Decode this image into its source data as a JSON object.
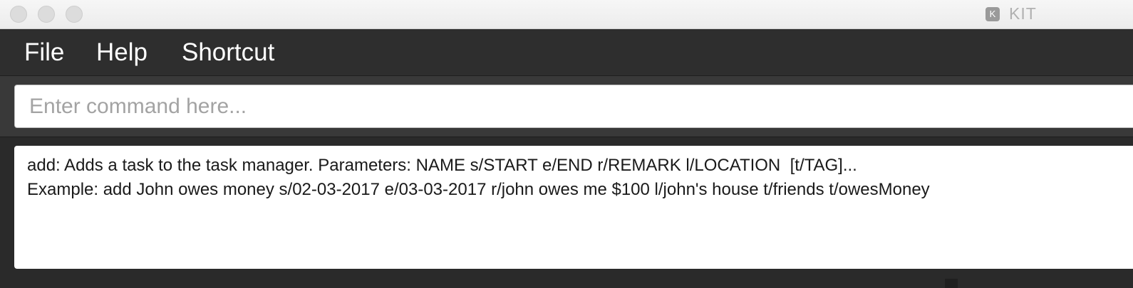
{
  "window": {
    "title": "KIT",
    "app_icon_letter": "K"
  },
  "menu": {
    "items": [
      {
        "label": "File"
      },
      {
        "label": "Help"
      },
      {
        "label": "Shortcut"
      }
    ]
  },
  "command": {
    "value": "",
    "placeholder": "Enter command here..."
  },
  "result": {
    "lines": [
      "add: Adds a task to the task manager. Parameters: NAME s/START e/END r/REMARK l/LOCATION  [t/TAG]...",
      "Example: add John owes money s/02-03-2017 e/03-03-2017 r/john owes me $100 l/john's house t/friends t/owesMoney"
    ]
  },
  "icons": {
    "close": "close-button-icon",
    "minimize": "minimize-button-icon",
    "zoom": "zoom-button-icon",
    "app": "app-icon"
  }
}
